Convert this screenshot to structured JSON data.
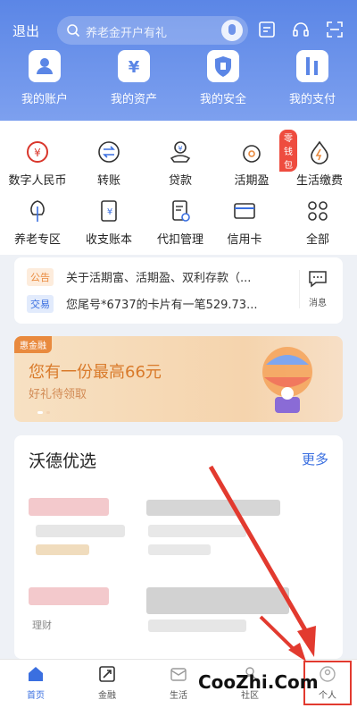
{
  "header": {
    "exit": "退出",
    "search_placeholder": "养老金开户有礼",
    "quick": [
      {
        "label": "我的账户",
        "icon": "person-icon"
      },
      {
        "label": "我的资产",
        "icon": "yuan-icon"
      },
      {
        "label": "我的安全",
        "icon": "shield-icon"
      },
      {
        "label": "我的支付",
        "icon": "pay-icon"
      }
    ]
  },
  "services": [
    {
      "label": "数字人民币",
      "icon": "digital-rmb-icon"
    },
    {
      "label": "转账",
      "icon": "transfer-icon"
    },
    {
      "label": "贷款",
      "icon": "loan-icon"
    },
    {
      "label": "活期盈",
      "icon": "money-bag-icon",
      "badge": "零钱包"
    },
    {
      "label": "生活缴费",
      "icon": "utility-icon"
    },
    {
      "label": "养老专区",
      "icon": "tree-icon"
    },
    {
      "label": "收支账本",
      "icon": "ledger-icon"
    },
    {
      "label": "代扣管理",
      "icon": "document-icon"
    },
    {
      "label": "信用卡",
      "icon": "card-icon"
    },
    {
      "label": "全部",
      "icon": "grid-icon"
    }
  ],
  "notices": [
    {
      "tag": "公告",
      "text": "关于活期富、活期盈、双利存款（..."
    },
    {
      "tag": "交易",
      "text": "您尾号*6737的卡片有一笔529.73..."
    }
  ],
  "message_label": "消息",
  "banner": {
    "logo": "惠金融",
    "title": "您有一份最高66元",
    "subtitle": "好礼待领取"
  },
  "section": {
    "title": "沃德优选",
    "more": "更多",
    "tag": "理财"
  },
  "tabs": [
    {
      "label": "首页",
      "icon": "home-icon"
    },
    {
      "label": "金融",
      "icon": "finance-icon"
    },
    {
      "label": "生活",
      "icon": "life-icon"
    },
    {
      "label": "社区",
      "icon": "community-icon"
    },
    {
      "label": "个人",
      "icon": "person-tab-icon"
    }
  ],
  "watermark": "CooZhi.Com",
  "colors": {
    "header": "#5b86e6",
    "accent": "#3a6fe0",
    "highlight": "#e23a2f",
    "banner_text": "#d97a2a"
  }
}
